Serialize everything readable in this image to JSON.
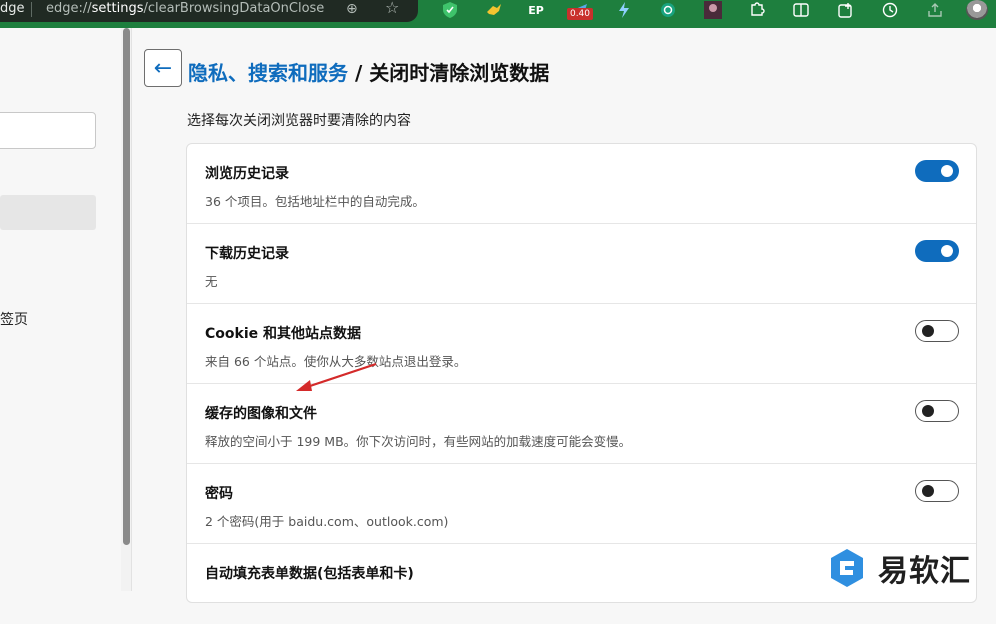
{
  "browser": {
    "tab_fragment": "dge",
    "address": "edge://settings/clearBrowsingDataOnClose",
    "address_host": "settings",
    "address_prefix": "edge://",
    "address_path": "/clearBrowsingDataOnClose",
    "extension_badge": "0.40",
    "extension_label": "EP"
  },
  "sidebar": {
    "partial_item": "签页"
  },
  "page": {
    "breadcrumb_parent": "隐私、搜索和服务",
    "breadcrumb_sep": " / ",
    "title": "关闭时清除浏览数据",
    "subtitle": "选择每次关闭浏览器时要清除的内容"
  },
  "items": [
    {
      "title": "浏览历史记录",
      "desc": "36 个项目。包括地址栏中的自动完成。",
      "enabled": true
    },
    {
      "title": "下载历史记录",
      "desc": "无",
      "enabled": true
    },
    {
      "title": "Cookie 和其他站点数据",
      "desc": "来自 66 个站点。使你从大多数站点退出登录。",
      "enabled": false
    },
    {
      "title": "缓存的图像和文件",
      "desc": "释放的空间小于 199 MB。你下次访问时，有些网站的加载速度可能会变慢。",
      "enabled": false
    },
    {
      "title": "密码",
      "desc": "2 个密码(用于 baidu.com、outlook.com)",
      "enabled": false
    },
    {
      "title": "自动填充表单数据(包括表单和卡)",
      "desc": "",
      "enabled": false
    }
  ],
  "watermark": {
    "text": "易软汇"
  },
  "colors": {
    "accent": "#0f6cbd",
    "titlebar": "#1e7f3e",
    "arrow": "#d42a2a"
  }
}
